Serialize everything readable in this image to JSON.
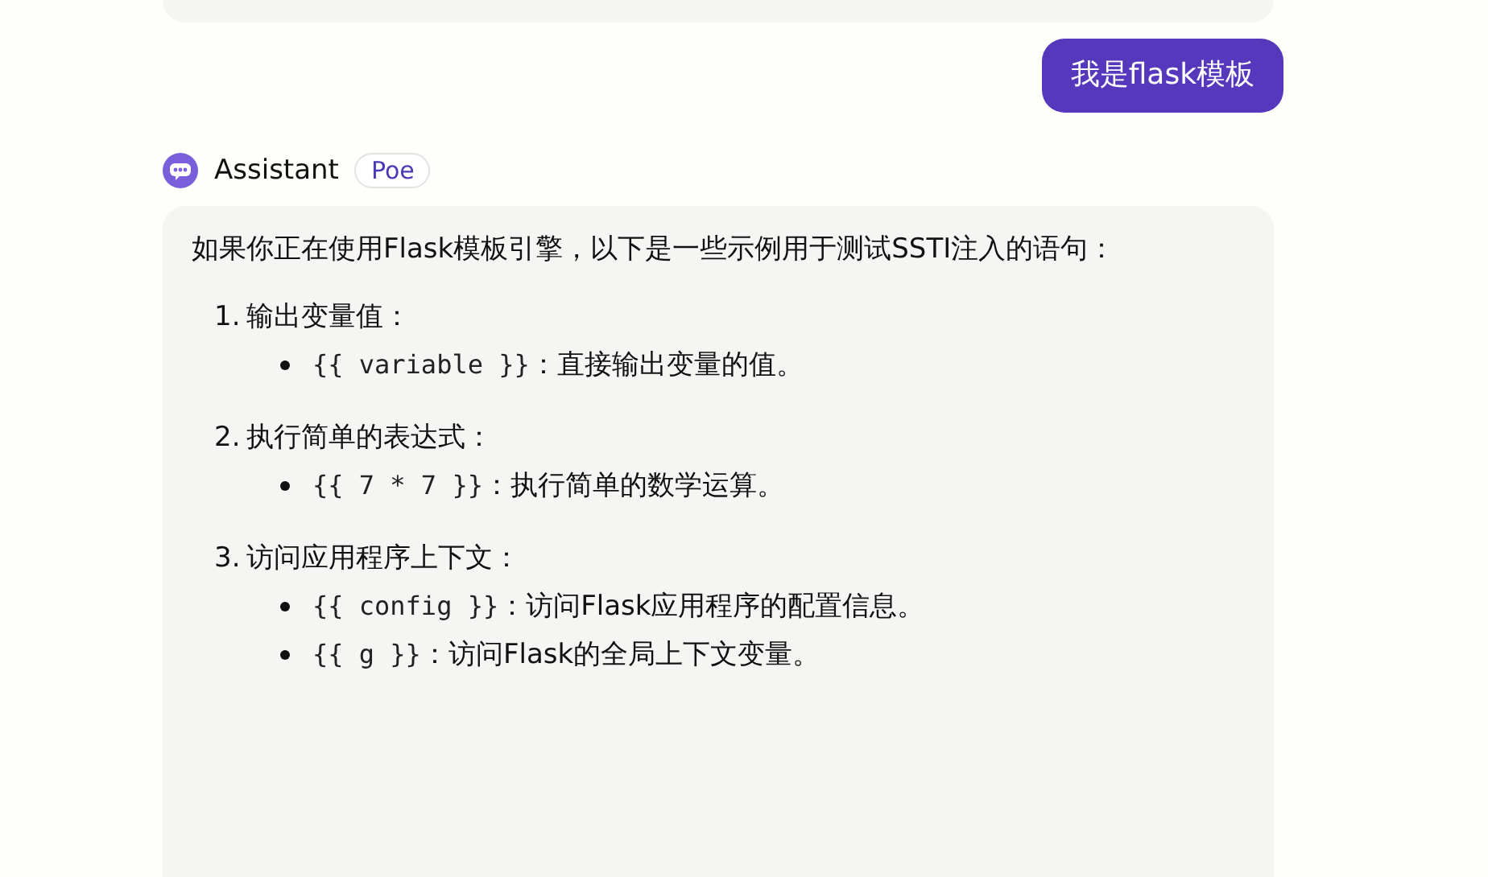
{
  "user_message": "我是flask模板",
  "assistant": {
    "name": "Assistant",
    "badge": "Poe"
  },
  "reply": {
    "intro": "如果你正在使用Flask模板引擎，以下是一些示例用于测试SSTI注入的语句：",
    "sections": [
      {
        "number": "1.",
        "title": "输出变量值：",
        "items": [
          {
            "code": "{{ variable }}",
            "text": "：直接输出变量的值。"
          }
        ]
      },
      {
        "number": "2.",
        "title": "执行简单的表达式：",
        "items": [
          {
            "code": "{{ 7 * 7 }}",
            "text": "：执行简单的数学运算。"
          }
        ]
      },
      {
        "number": "3.",
        "title": "访问应用程序上下文：",
        "items": [
          {
            "code": "{{ config }}",
            "text": "：访问Flask应用程序的配置信息。"
          },
          {
            "code": "{{ g }}",
            "text": "：访问Flask的全局上下文变量。"
          }
        ]
      }
    ]
  }
}
